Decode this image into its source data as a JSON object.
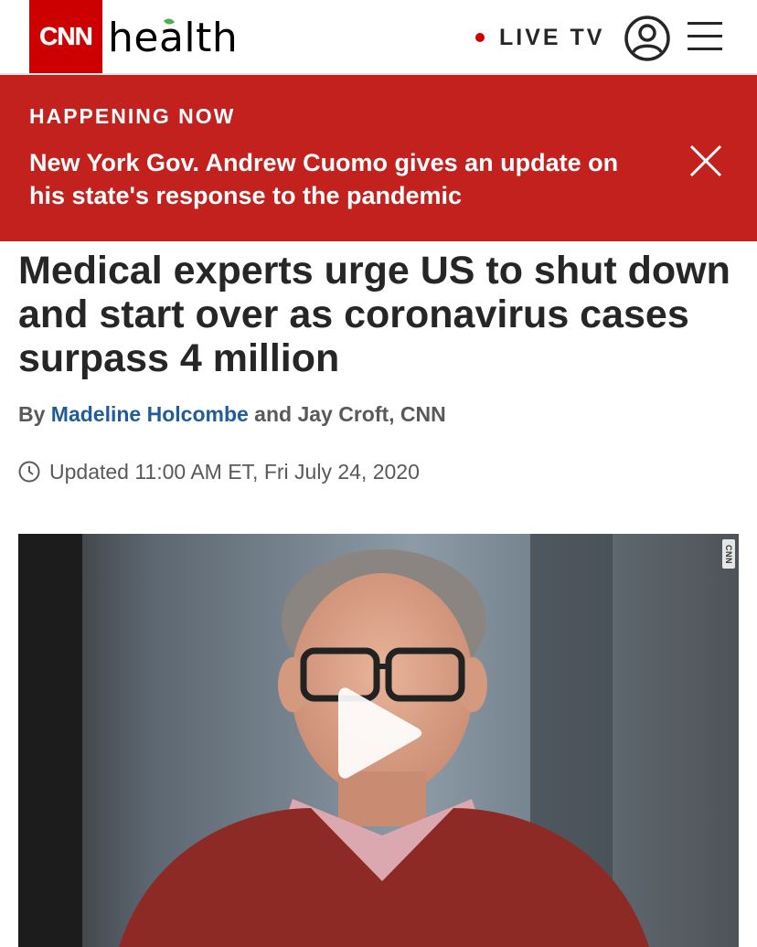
{
  "header": {
    "logo_text": "CNN",
    "section_name": "health",
    "live_tv_label": "LIVE TV",
    "account_icon": "user-circle-icon",
    "menu_icon": "hamburger-menu-icon"
  },
  "banner": {
    "kicker": "HAPPENING NOW",
    "headline": "New York Gov. Andrew Cuomo gives an update on his state's response to the pandemic",
    "close_icon": "close-icon"
  },
  "article": {
    "headline": "Medical experts urge US to shut down and start over as coronavirus cases surpass 4 million",
    "byline_prefix": "By",
    "author_primary": "Madeline Holcombe",
    "byline_rest": "and Jay Croft, CNN",
    "updated": "Updated 11:00 AM ET, Fri July 24, 2020"
  },
  "video": {
    "watermark": "CNN",
    "play_icon": "play-icon"
  },
  "colors": {
    "brand_red": "#cc0000",
    "banner_red": "#c2211d",
    "link_blue": "#1f5c99",
    "text_dark": "#262626",
    "text_muted": "#595959"
  }
}
